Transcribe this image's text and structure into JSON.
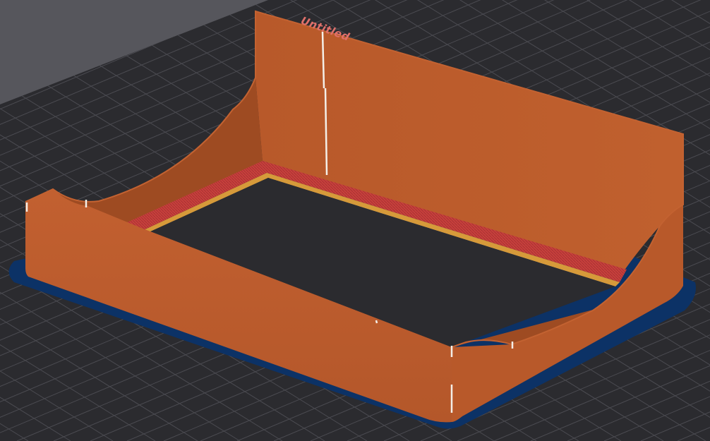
{
  "plate": {
    "label": "Untitled"
  },
  "colors": {
    "background": "#56565c",
    "bed": "#2b2b2f",
    "grid": "#4b4b51",
    "model": "#b8592a",
    "model_light": "#c36231",
    "model_shadow": "#9e4b22",
    "top_layer": "#c8403c",
    "infill_edge": "#d69a3a",
    "brim_shadow": "#0c3266",
    "seam": "#f4efe8",
    "label": "#e0706a"
  },
  "model": {
    "name": "tray",
    "seams": 4
  }
}
